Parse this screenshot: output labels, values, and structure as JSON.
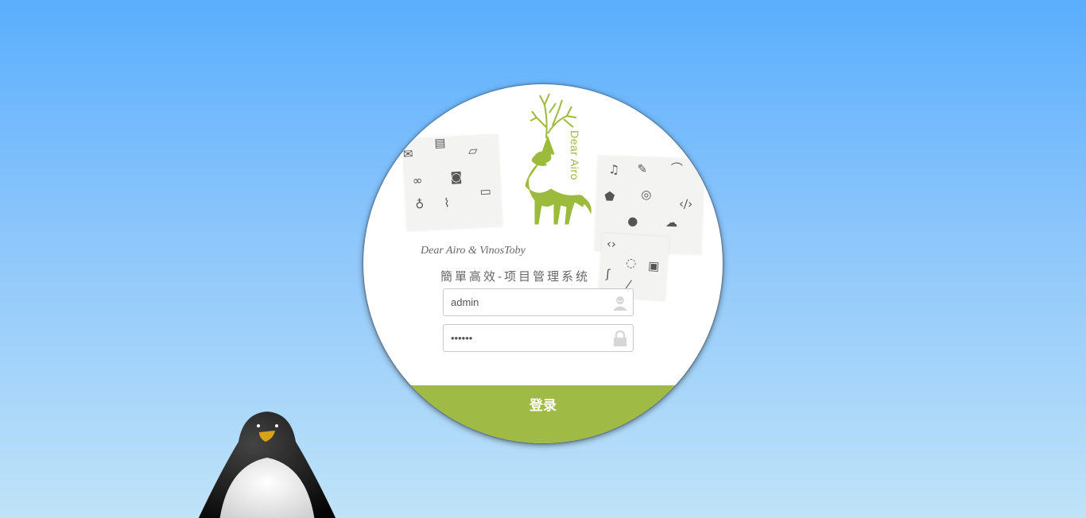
{
  "brand": {
    "vertical": "Dear Airo",
    "credit": "Dear Airo & VinosToby",
    "slogan": "簡單高效-项目管理系统"
  },
  "login": {
    "username_value": "admin",
    "password_value": "123456",
    "submit_label": "登录"
  },
  "icons": {
    "username_icon": "user-icon",
    "password_icon": "lock-icon"
  },
  "colors": {
    "accent_green": "#9fbb45",
    "background_top": "#5aaefc",
    "background_bottom": "#bfe3f8"
  }
}
